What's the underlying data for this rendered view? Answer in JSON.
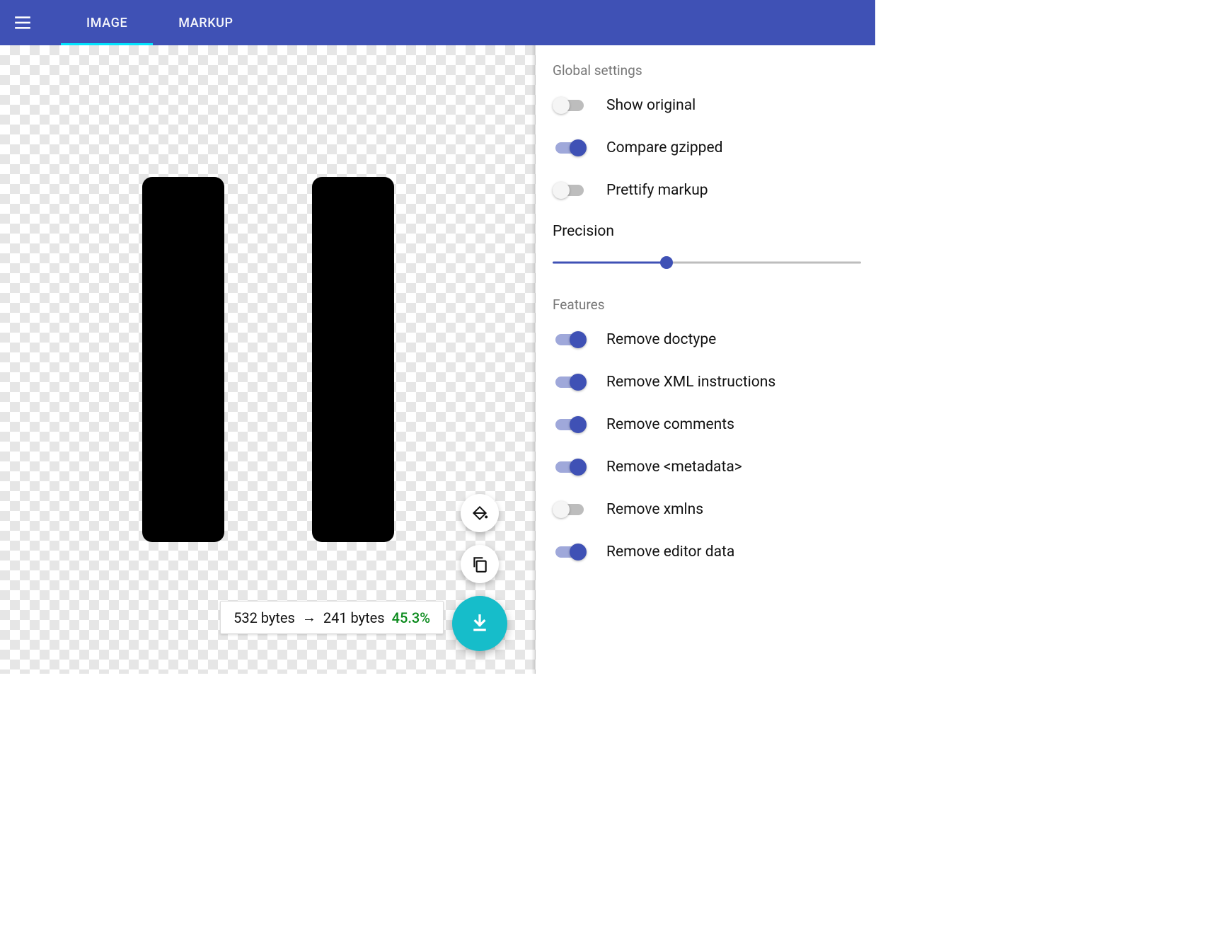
{
  "colors": {
    "primary": "#3f51b5",
    "accent_tab": "#00e5ff",
    "fab": "#16bdca",
    "pct_green": "#0a8a1c"
  },
  "tabs": {
    "image": "IMAGE",
    "markup": "MARKUP",
    "active": "image"
  },
  "size": {
    "before": "532 bytes",
    "arrow": "→",
    "after": "241 bytes",
    "pct": "45.3%"
  },
  "panel": {
    "global_title": "Global settings",
    "features_title": "Features",
    "precision_label": "Precision",
    "precision_pct": 37,
    "settings": {
      "show_original": {
        "label": "Show original",
        "on": false
      },
      "compare_gzipped": {
        "label": "Compare gzipped",
        "on": true
      },
      "prettify": {
        "label": "Prettify markup",
        "on": false
      }
    },
    "features": {
      "remove_doctype": {
        "label": "Remove doctype",
        "on": true
      },
      "remove_xml_instr": {
        "label": "Remove XML instructions",
        "on": true
      },
      "remove_comments": {
        "label": "Remove comments",
        "on": true
      },
      "remove_metadata": {
        "label": "Remove <metadata>",
        "on": true
      },
      "remove_xmlns": {
        "label": "Remove xmlns",
        "on": false
      },
      "remove_editor": {
        "label": "Remove editor data",
        "on": true
      }
    }
  },
  "icons": {
    "menu": "menu-icon",
    "bucket": "paint-bucket-icon",
    "copy": "copy-icon",
    "download": "download-icon"
  }
}
